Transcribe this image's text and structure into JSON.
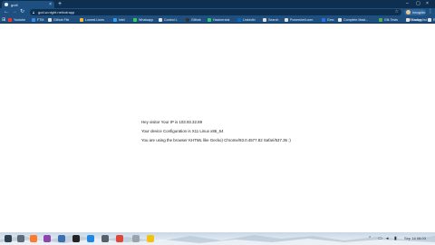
{
  "tab": {
    "title": "gcdt"
  },
  "window": {
    "minimize": "–",
    "maximize": "▢",
    "close": "×"
  },
  "address_bar": {
    "url": "gcd-w.night.net/cdrapp"
  },
  "profile": {
    "name": "Incognito"
  },
  "bookmarks": [
    {
      "label": "Youtube",
      "color": "#ff2a2a"
    },
    {
      "label": "FTM",
      "color": "#3b8cf0"
    },
    {
      "label": "Github File",
      "color": "#e2e2e2"
    },
    {
      "label": "Lowest Lines",
      "color": "#f2b72a"
    },
    {
      "label": "Intel",
      "color": "#2aa4f2"
    },
    {
      "label": "Whatsapp",
      "color": "#2fcf5a"
    },
    {
      "label": "Control L",
      "color": "#e2e2e2"
    },
    {
      "label": "Github",
      "color": "#333333"
    },
    {
      "label": "Hackerrank",
      "color": "#2ec866"
    },
    {
      "label": "LinkedIn",
      "color": "#0a66c2"
    },
    {
      "label": "Search",
      "color": "#e2e2e2"
    },
    {
      "label": "Powershell.com",
      "color": "#e2e2e2"
    },
    {
      "label": "Gmx",
      "color": "#2a6ef2"
    },
    {
      "label": "Complete Mast...",
      "color": "#e2e2e2"
    },
    {
      "label": "Gfk Tests",
      "color": "#4caf50"
    },
    {
      "label": "Groups",
      "color": "#e2e2e2"
    },
    {
      "label": "R",
      "color": "#e2e2e2"
    }
  ],
  "reading_list": "Reading list",
  "content": {
    "line1": "Hey visitor Your IP is 103.93.32.89",
    "line2": "Your device Configuration is X11 Linux x86_64",
    "line3": "You are using the browser KHTML like Gecko) Chrome/93.0.4577.82 Safari/537.36 :)"
  },
  "taskbar": {
    "clock": "Sep 18  08:03",
    "apps": [
      {
        "name": "start",
        "color": "#2c3e50"
      },
      {
        "name": "files",
        "color": "#5b6b7b"
      },
      {
        "name": "firefox",
        "color": "#ff7b2a"
      },
      {
        "name": "apps",
        "color": "#8e44ad"
      },
      {
        "name": "browser",
        "color": "#3a6fb0"
      },
      {
        "name": "terminal",
        "color": "#222222"
      },
      {
        "name": "vscode",
        "color": "#1e88e5"
      },
      {
        "name": "folder",
        "color": "#56606b"
      },
      {
        "name": "chrome",
        "color": "#e0453a"
      },
      {
        "name": "settings",
        "color": "#9aa3ac"
      },
      {
        "name": "store",
        "color": "#f4c20d"
      }
    ]
  }
}
